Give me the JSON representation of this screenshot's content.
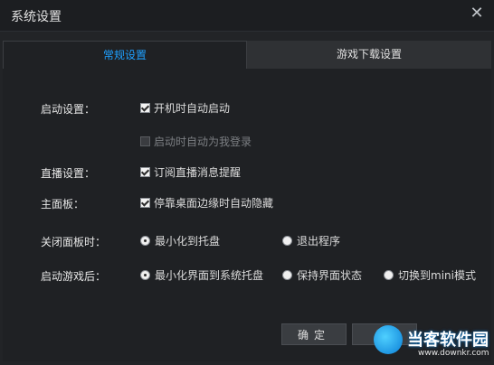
{
  "window": {
    "title": "系统设置",
    "close_glyph": "✕"
  },
  "tabs": [
    {
      "label": "常规设置",
      "active": true
    },
    {
      "label": "游戏下载设置",
      "active": false
    }
  ],
  "settings": {
    "startup": {
      "label": "启动设置：",
      "options": [
        {
          "label": "开机时自动启动",
          "checked": true,
          "enabled": true
        },
        {
          "label": "启动时自动为我登录",
          "checked": false,
          "enabled": false
        }
      ]
    },
    "live": {
      "label": "直播设置：",
      "options": [
        {
          "label": "订阅直播消息提醒",
          "checked": true,
          "enabled": true
        }
      ]
    },
    "panel": {
      "label": "主面板：",
      "options": [
        {
          "label": "停靠桌面边缘时自动隐藏",
          "checked": true,
          "enabled": true
        }
      ]
    },
    "close_panel": {
      "label": "关闭面板时：",
      "options": [
        {
          "label": "最小化到托盘",
          "selected": true
        },
        {
          "label": "退出程序",
          "selected": false
        }
      ]
    },
    "after_game": {
      "label": "启动游戏后：",
      "options": [
        {
          "label": "最小化界面到系统托盘",
          "selected": true
        },
        {
          "label": "保持界面状态",
          "selected": false
        },
        {
          "label": "切换到mini模式",
          "selected": false
        }
      ]
    }
  },
  "buttons": {
    "ok": "确定",
    "cancel": "取"
  },
  "watermark": {
    "text": "当客软件园",
    "url": "www.downkr.com"
  },
  "colors": {
    "accent": "#1ea0ff",
    "background": "#1f2124",
    "tab_bar": "#2f3134"
  }
}
